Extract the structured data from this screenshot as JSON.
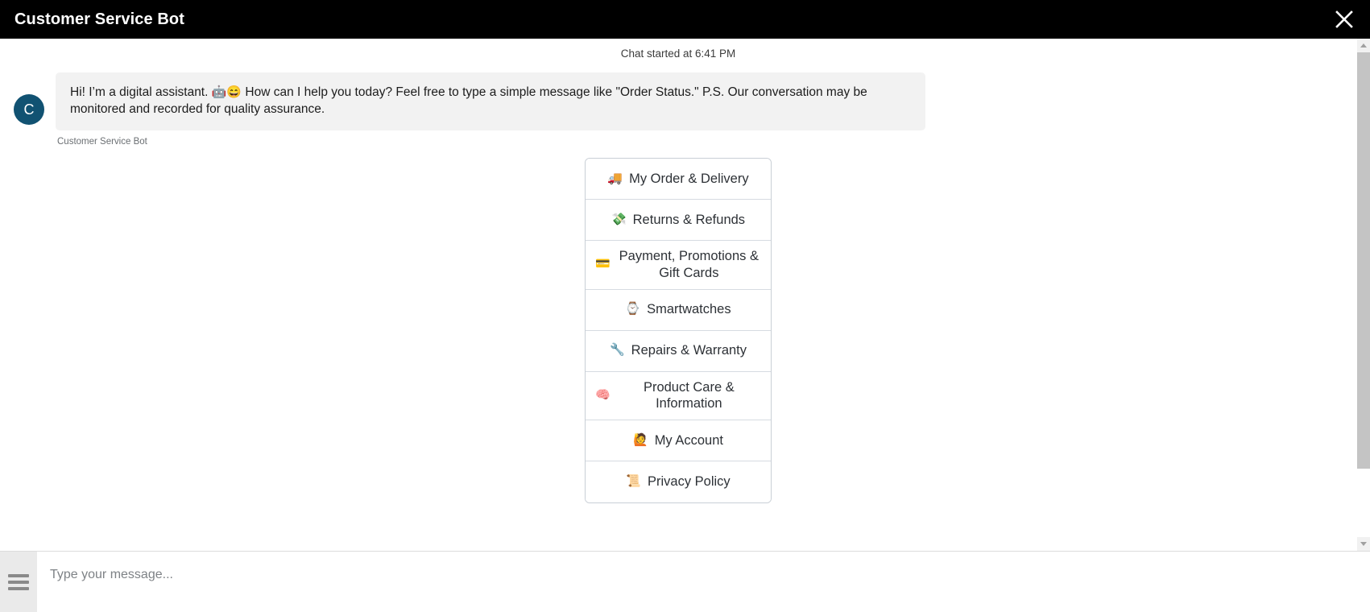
{
  "header": {
    "title": "Customer Service Bot",
    "close_icon": "close-icon"
  },
  "transcript": {
    "chat_started": "Chat started at 6:41 PM",
    "message": {
      "avatar_initial": "C",
      "avatar_color": "#115272",
      "text_part1": "Hi! I’m a digital assistant. ",
      "emoji1": "🤖",
      "emoji2": "😄",
      "text_part2": " How can I help you today? Feel free to type a simple message like \"Order Status.\" P.S. Our conversation may be monitored and recorded for quality assurance.",
      "sender": "Customer Service Bot"
    }
  },
  "quick_menu": {
    "items": [
      {
        "emoji": "🚚",
        "icon_name": "delivery-truck-icon",
        "label": "My Order & Delivery"
      },
      {
        "emoji": "💸",
        "icon_name": "money-with-wings-icon",
        "label": "Returns & Refunds"
      },
      {
        "emoji": "💳",
        "icon_name": "credit-card-icon",
        "label": "Payment, Promotions & Gift Cards"
      },
      {
        "emoji": "⌚",
        "icon_name": "watch-icon",
        "label": "Smartwatches"
      },
      {
        "emoji": "🔧",
        "icon_name": "wrench-icon",
        "label": "Repairs & Warranty"
      },
      {
        "emoji": "🧠",
        "icon_name": "brain-icon",
        "label": "Product Care & Information"
      },
      {
        "emoji": "🙋",
        "icon_name": "person-raising-hand-icon",
        "label": "My Account"
      },
      {
        "emoji": "📜",
        "icon_name": "scroll-icon",
        "label": "Privacy Policy"
      }
    ]
  },
  "composer": {
    "menu_icon": "hamburger-menu-icon",
    "input_value": "",
    "input_placeholder": "Type your message..."
  },
  "scrollbar": {
    "up_icon": "scroll-up-arrow-icon",
    "down_icon": "scroll-down-arrow-icon"
  },
  "colors": {
    "header_bg": "#000000",
    "bubble_bg": "#f2f2f2",
    "avatar_bg": "#115272",
    "composer_bg": "#eaeaea"
  }
}
